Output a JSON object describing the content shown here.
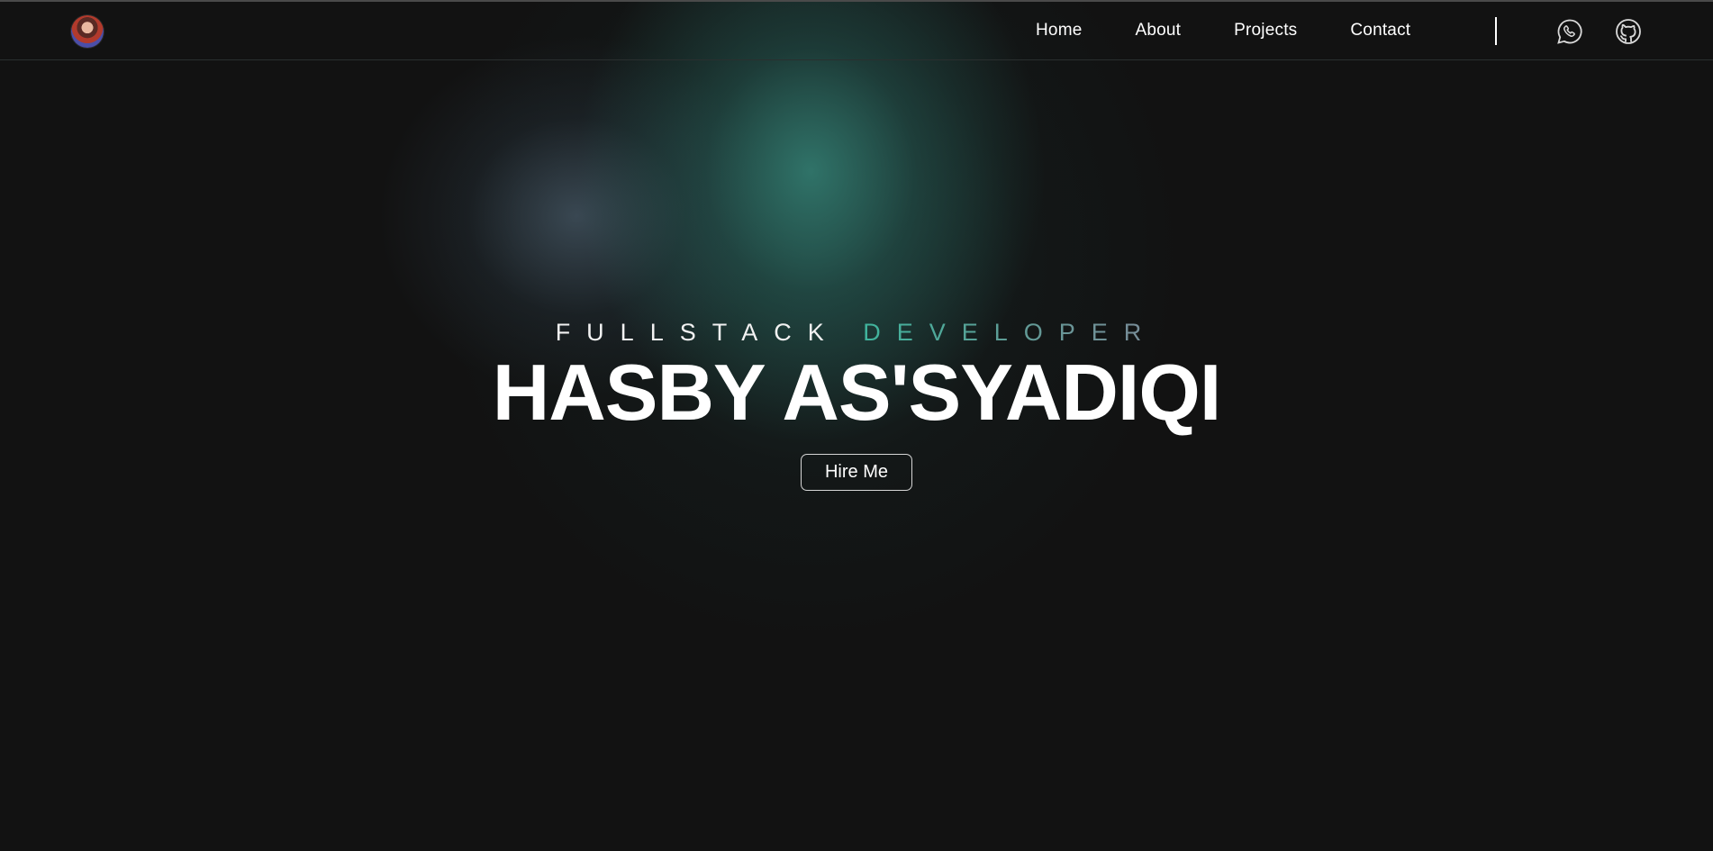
{
  "nav": {
    "logo_alt": "profile avatar",
    "links": [
      {
        "label": "Home"
      },
      {
        "label": "About"
      },
      {
        "label": "Projects"
      },
      {
        "label": "Contact"
      }
    ],
    "icons": [
      {
        "name": "whatsapp-icon"
      },
      {
        "name": "github-icon"
      }
    ]
  },
  "hero": {
    "subtitle_part1": "FULLSTACK",
    "subtitle_part2": "DEVELOPER",
    "name": "HASBY AS'SYADIQI",
    "cta_label": "Hire Me"
  },
  "colors": {
    "background": "#121212",
    "accent_teal": "#3fb59d",
    "accent_gray": "#7a8b98",
    "text": "#ffffff"
  }
}
